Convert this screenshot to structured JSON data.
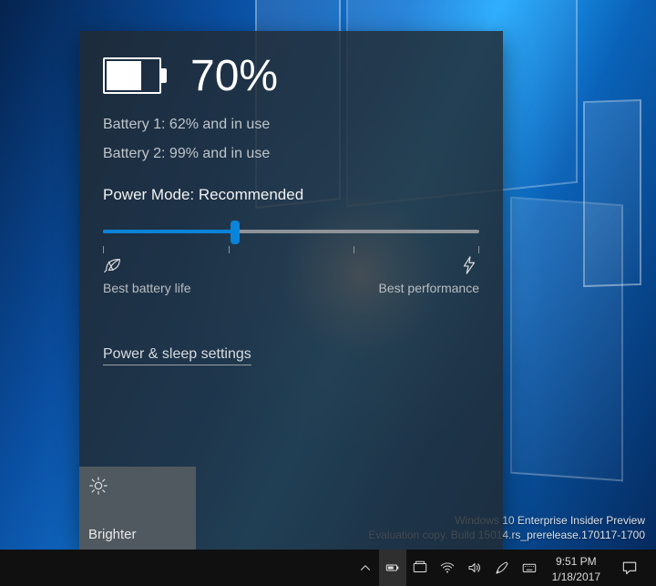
{
  "battery": {
    "overall_percent": "70%",
    "line1": "Battery 1: 62% and in use",
    "line2": "Battery 2: 99% and in use",
    "mode_label": "Power Mode: Recommended",
    "left_label": "Best battery life",
    "right_label": "Best performance",
    "settings_link": "Power & sleep settings",
    "bright_label": "Brighter",
    "slider_percent": 35
  },
  "watermark": {
    "line1": "Windows 10 Enterprise Insider Preview",
    "line2": "Evaluation copy. Build 15014.rs_prerelease.170117-1700"
  },
  "clock": {
    "time": "9:51 PM",
    "date": "1/18/2017"
  }
}
